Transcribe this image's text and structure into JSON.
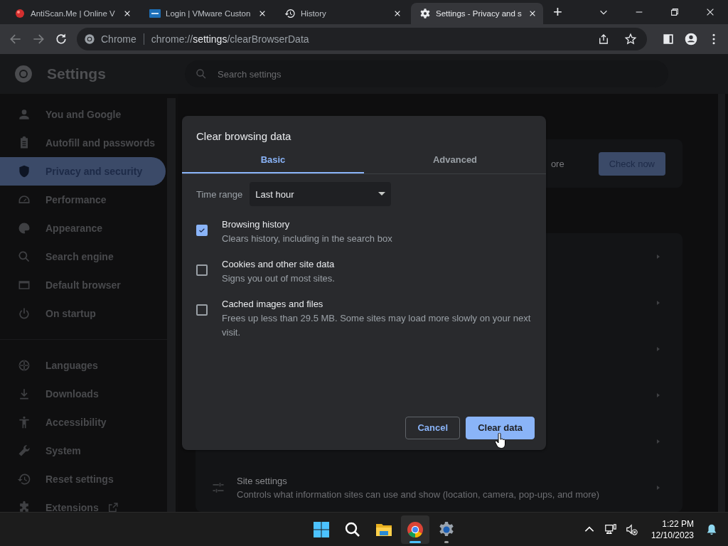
{
  "browser": {
    "tabs": [
      {
        "title": "AntiScan.Me | Online V",
        "kind": "antiscan",
        "selected": false
      },
      {
        "title": "Login | VMware Custon",
        "kind": "vmware",
        "selected": false
      },
      {
        "title": "History",
        "kind": "history",
        "selected": false
      },
      {
        "title": "Settings - Privacy and s",
        "kind": "settings",
        "selected": true
      }
    ],
    "new_tab": "+",
    "address": {
      "site_label": "Chrome",
      "scheme": "chrome://",
      "host": "settings",
      "path": "/clearBrowserData"
    }
  },
  "settings": {
    "title": "Settings",
    "search": {
      "placeholder": "Search settings"
    },
    "sidebar": {
      "groups": [
        [
          {
            "label": "You and Google",
            "selected": false
          },
          {
            "label": "Autofill and passwords",
            "selected": false
          },
          {
            "label": "Privacy and security",
            "selected": true
          },
          {
            "label": "Performance",
            "selected": false
          },
          {
            "label": "Appearance",
            "selected": false
          },
          {
            "label": "Search engine",
            "selected": false
          },
          {
            "label": "Default browser",
            "selected": false
          },
          {
            "label": "On startup",
            "selected": false
          }
        ],
        [
          {
            "label": "Languages",
            "selected": false
          },
          {
            "label": "Downloads",
            "selected": false
          },
          {
            "label": "Accessibility",
            "selected": false
          },
          {
            "label": "System",
            "selected": false
          },
          {
            "label": "Reset settings",
            "selected": false
          },
          {
            "label": "Extensions",
            "selected": false,
            "external": true
          }
        ]
      ]
    },
    "safety_check": {
      "text": "ore",
      "button": "Check now"
    },
    "rows": [
      {
        "title": "Site settings",
        "description": "Controls what information sites can use and show (location, camera, pop-ups, and more)"
      }
    ]
  },
  "dialog": {
    "title": "Clear browsing data",
    "tabs": [
      {
        "label": "Basic",
        "selected": true
      },
      {
        "label": "Advanced",
        "selected": false
      }
    ],
    "time_range": {
      "label": "Time range",
      "value": "Last hour"
    },
    "items": [
      {
        "label": "Browsing history",
        "description": "Clears history, including in the search box",
        "checked": true
      },
      {
        "label": "Cookies and other site data",
        "description": "Signs you out of most sites.",
        "checked": false
      },
      {
        "label": "Cached images and files",
        "description": "Frees up less than 29.5 MB. Some sites may load more slowly on your next visit.",
        "checked": false
      }
    ],
    "buttons": [
      {
        "label": "Cancel",
        "kind": "secondary"
      },
      {
        "label": "Clear data",
        "kind": "primary"
      }
    ]
  },
  "taskbar": {
    "apps": [
      {
        "kind": "start",
        "selected": false,
        "running": false
      },
      {
        "kind": "search",
        "selected": false,
        "running": false
      },
      {
        "kind": "explorer",
        "selected": false,
        "running": false
      },
      {
        "kind": "chrome",
        "selected": true,
        "running": true
      },
      {
        "kind": "settings",
        "selected": false,
        "running": true
      }
    ],
    "time": "1:22 PM",
    "date": "12/10/2023"
  }
}
